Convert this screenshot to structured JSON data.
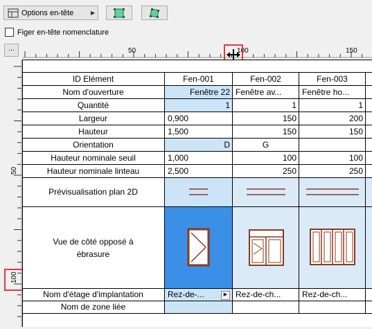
{
  "toolbar": {
    "options_label": "Options en-tête",
    "freeze_label": "Figer en-tête nomenclature",
    "corner_label": "..."
  },
  "rulers": {
    "horizontal_labels": [
      "50",
      "100",
      "150"
    ],
    "vertical_labels": [
      "50",
      "100"
    ]
  },
  "colors": {
    "selected_cell": "#3b8fe6",
    "selected_row": "#cce4f7",
    "highlight": "#e8383d",
    "symbol_stroke": "#8b3a1e"
  },
  "schedule": {
    "header": {
      "label": "ID Elément",
      "columns": [
        "Fen-001",
        "Fen-002",
        "Fen-003"
      ]
    },
    "rows": {
      "opening_name": {
        "label": "Nom d'ouverture",
        "values": [
          "Fenêtre 22",
          "Fenêtre av...",
          "Fenêtre ho..."
        ]
      },
      "quantity": {
        "label": "Quantité",
        "values": [
          "1",
          "1",
          "1"
        ]
      },
      "width": {
        "label": "Largeur",
        "values": [
          "0,900",
          "150",
          "200"
        ]
      },
      "height": {
        "label": "Hauteur",
        "values": [
          "1,500",
          "150",
          "150"
        ]
      },
      "orientation": {
        "label": "Orientation",
        "values": [
          "D",
          "G",
          ""
        ]
      },
      "sill_height": {
        "label": "Hauteur nominale seuil",
        "values": [
          "1,000",
          "100",
          "100"
        ]
      },
      "lintel_height": {
        "label": "Hauteur nominale linteau",
        "values": [
          "2,500",
          "250",
          "250"
        ]
      },
      "plan_preview": {
        "label": "Prévisualisation plan 2D"
      },
      "side_view": {
        "label": "Vue de côté opposé à ébrasure"
      },
      "story": {
        "label": "Nom d'étage d'implantation",
        "values": [
          "Rez-de-...",
          "Rez-de-ch...",
          "Rez-de-ch..."
        ]
      },
      "zone": {
        "label": "Nom de zone liée",
        "values": [
          "",
          "",
          ""
        ]
      }
    }
  }
}
